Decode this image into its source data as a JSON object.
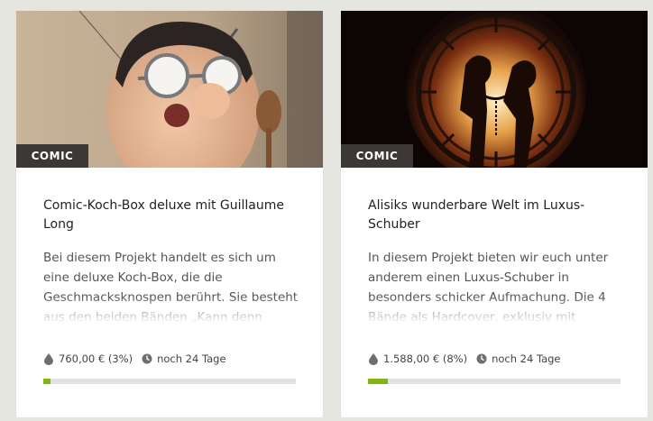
{
  "projects": [
    {
      "tag": "COMIC",
      "title": "Comic-Koch-Box deluxe mit Guillaume Long",
      "description": "Bei diesem Projekt handelt es sich um eine deluxe Koch-Box, die die Geschmacksknospen berührt. Sie besteht aus den beiden Bänden „Kann denn",
      "funding": "760,00 € (3%)",
      "remaining": "noch 24 Tage",
      "progress_percent": 3
    },
    {
      "tag": "COMIC",
      "title": "Alisiks wunderbare Welt im Luxus-Schuber",
      "description": "In diesem Projekt bieten wir euch unter anderem einen Luxus-Schuber in besonders schicker Aufmachung. Die 4 Bände als Hardcover, exklusiv mit",
      "funding": "1.588,00 € (8%)",
      "remaining": "noch 24 Tage",
      "progress_percent": 8
    }
  ],
  "colors": {
    "page_background": "#e6e6e1",
    "tag_background": "#3b3835",
    "progress_fill": "#82b414",
    "progress_track": "#dfe3e3"
  },
  "icons": {
    "funding": "drop-icon",
    "remaining": "clock-icon"
  }
}
